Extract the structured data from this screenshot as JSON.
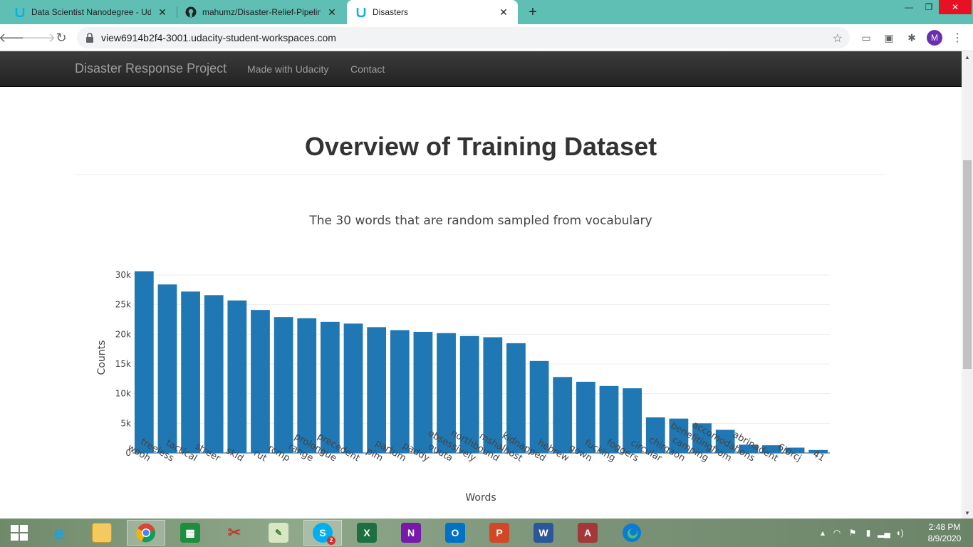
{
  "browser": {
    "tabs": [
      {
        "title": "Data Scientist Nanodegree - Uda",
        "active": false
      },
      {
        "title": "mahumz/Disaster-Relief-Pipeline",
        "active": false
      },
      {
        "title": "Disasters",
        "active": true
      }
    ],
    "url": "view6914b2f4-3001.udacity-student-workspaces.com",
    "profile_initial": "M"
  },
  "navbar": {
    "brand": "Disaster Response Project",
    "links": [
      "Made with Udacity",
      "Contact"
    ]
  },
  "main": {
    "title": "Overview of Training Dataset"
  },
  "chart_data": {
    "type": "bar",
    "title": "The 30 words that are random sampled from vocabulary",
    "xlabel": "Words",
    "ylabel": "Counts",
    "ylim": [
      0,
      30000
    ],
    "yticks": [
      0,
      5000,
      10000,
      15000,
      20000,
      25000,
      30000
    ],
    "ytick_labels": [
      "0",
      "5k",
      "10k",
      "15k",
      "20k",
      "25k",
      "30k"
    ],
    "grid": true,
    "color": "#1f77b4",
    "categories": [
      "wooh",
      "treeless",
      "tactical",
      "streer",
      "skid",
      "rut",
      "rcmp",
      "range",
      "prolongue",
      "precedent",
      "pim",
      "partum",
      "paddy",
      "ouuta",
      "obsessively",
      "northbound",
      "mshalhost",
      "kidnapped",
      "hebrew",
      "gown",
      "fucking",
      "foggers",
      "circular",
      "chirgaon",
      "camping",
      "benefitingfrom",
      "accomodations",
      "abrinadent",
      "6j0rcj",
      "41"
    ],
    "values": [
      30600,
      28400,
      27200,
      26600,
      25700,
      24100,
      22900,
      22700,
      22100,
      21800,
      21200,
      20700,
      20400,
      20200,
      19700,
      19500,
      18500,
      15500,
      12800,
      12000,
      11300,
      10900,
      6000,
      5800,
      5000,
      3900,
      1400,
      1300,
      900,
      500
    ]
  },
  "taskbar": {
    "apps": [
      "start",
      "internet-explorer",
      "file-explorer",
      "chrome",
      "store",
      "snipping-tool",
      "notepad-plus",
      "skype",
      "excel",
      "onenote",
      "outlook",
      "powerpoint",
      "word",
      "access",
      "edge"
    ],
    "skype_badge": "2",
    "time": "2:48 PM",
    "date": "8/9/2020"
  }
}
